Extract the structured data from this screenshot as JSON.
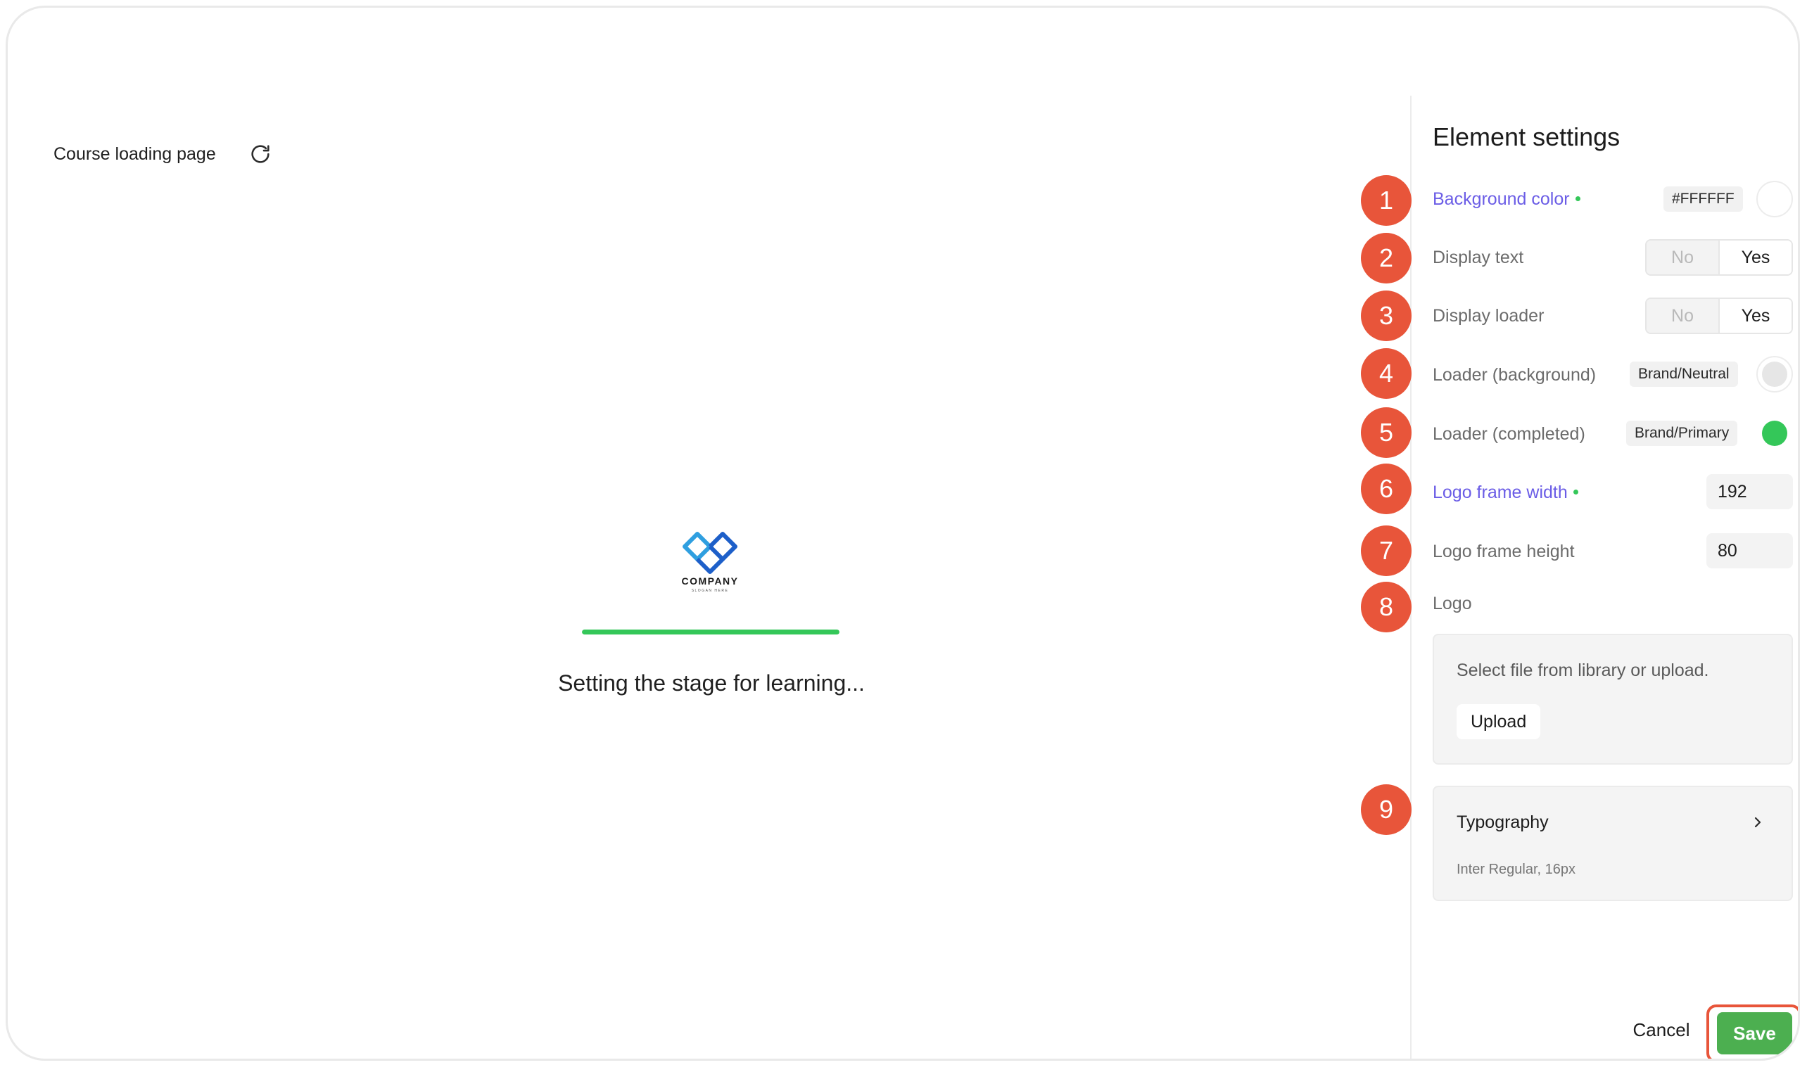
{
  "header": {
    "title": "Course loading page",
    "refresh_icon": "refresh-icon"
  },
  "preview": {
    "logo_icon": "company-logo",
    "logo_text": "COMPANY",
    "logo_slogan": "SLOGAN HERE",
    "progress": 1.0,
    "loading_text": "Setting the stage for learning..."
  },
  "panel": {
    "title": "Element settings",
    "badges": [
      "1",
      "2",
      "3",
      "4",
      "5",
      "6",
      "7",
      "8",
      "9"
    ],
    "background_color": {
      "label": "Background color",
      "value": "#FFFFFF",
      "swatch": "#FFFFFF"
    },
    "display_text": {
      "label": "Display text",
      "no": "No",
      "yes": "Yes",
      "selected": "Yes"
    },
    "display_loader": {
      "label": "Display loader",
      "no": "No",
      "yes": "Yes",
      "selected": "Yes"
    },
    "loader_background": {
      "label": "Loader (background)",
      "token": "Brand/Neutral",
      "swatch": "#E6E6E6"
    },
    "loader_completed": {
      "label": "Loader (completed)",
      "token": "Brand/Primary",
      "swatch": "#34C759"
    },
    "logo_frame_width": {
      "label": "Logo frame width",
      "value": "192"
    },
    "logo_frame_height": {
      "label": "Logo frame height",
      "value": "80"
    },
    "logo": {
      "label": "Logo",
      "hint": "Select file from library or upload.",
      "upload_label": "Upload"
    },
    "typography": {
      "title": "Typography",
      "value": "Inter Regular, 16px"
    }
  },
  "footer": {
    "cancel_label": "Cancel",
    "save_label": "Save"
  },
  "colors": {
    "accent_modified": "#6B5DE6",
    "badge": "#E8553A",
    "save": "#4CAF50",
    "loader": "#34C759"
  }
}
